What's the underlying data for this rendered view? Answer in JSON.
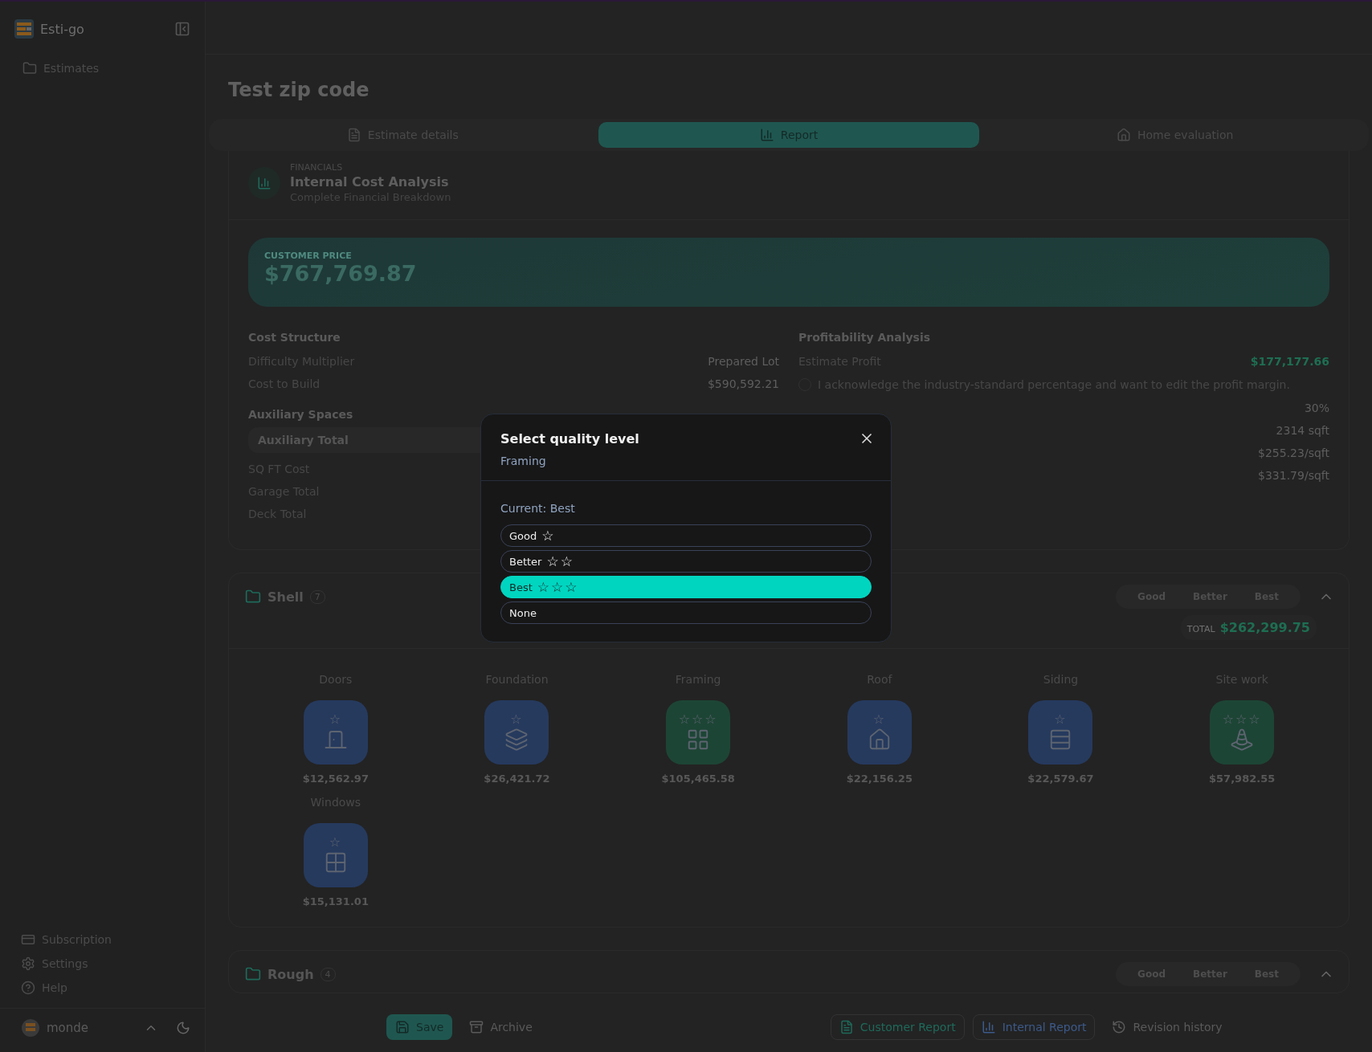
{
  "sidebar": {
    "brand": "Esti-go",
    "nav": [
      {
        "label": "Estimates",
        "kind": "folder"
      }
    ],
    "footer": [
      {
        "label": "Subscription",
        "kind": "card"
      },
      {
        "label": "Settings",
        "kind": "gear"
      },
      {
        "label": "Help",
        "kind": "help"
      }
    ],
    "user": "monde"
  },
  "page": {
    "title": "Test zip code"
  },
  "tabs": [
    {
      "label": "Estimate details",
      "kind": "doc",
      "selected": false
    },
    {
      "label": "Report",
      "kind": "chart",
      "selected": true
    },
    {
      "label": "Home evaluation",
      "kind": "house",
      "selected": false
    }
  ],
  "financials": {
    "eyebrow": "FINANCIALS",
    "title": "Internal Cost Analysis",
    "subtitle": "Complete Financial Breakdown",
    "customer_price": {
      "label": "CUSTOMER PRICE",
      "value": "$767,769.87"
    },
    "cost_structure": {
      "title": "Cost Structure",
      "rows": [
        {
          "label": "Difficulty Multiplier",
          "value": "Prepared Lot"
        },
        {
          "label": "Cost to Build",
          "value": "$590,592.21"
        }
      ]
    },
    "auxiliary": {
      "title": "Auxiliary Spaces",
      "total_label": "Auxiliary Total",
      "rows": [
        "SQ FT Cost",
        "Garage Total",
        "Deck Total"
      ]
    },
    "profitability": {
      "title": "Profitability Analysis",
      "profit_label": "Estimate Profit",
      "profit_value": "$177,177.66",
      "acknowledge": {
        "text": "I acknowledge the industry-standard percentage and want to edit the profit margin.",
        "checked": false
      },
      "values": [
        "30%",
        "2314 sqft",
        "$255.23/sqft",
        "$331.79/sqft"
      ]
    }
  },
  "sections": [
    {
      "name": "Shell",
      "count": "7",
      "expanded": true,
      "total_label": "TOTAL",
      "total": "$262,299.75",
      "quality_options": [
        {
          "label": "Good",
          "selected": false
        },
        {
          "label": "Better",
          "selected": false
        },
        {
          "label": "Best",
          "selected": false
        }
      ],
      "items": [
        {
          "name": "Doors",
          "price": "$12,562.97",
          "rating": "☆",
          "color": "#263a5e",
          "kind": "door"
        },
        {
          "name": "Foundation",
          "price": "$26,421.72",
          "rating": "☆",
          "color": "#263a5e",
          "kind": "layers"
        },
        {
          "name": "Framing",
          "price": "$105,465.58",
          "rating": "☆☆☆",
          "color": "#1d4535",
          "kind": "grid"
        },
        {
          "name": "Roof",
          "price": "$22,156.25",
          "rating": "☆",
          "color": "#263a5e",
          "kind": "house"
        },
        {
          "name": "Siding",
          "price": "$22,579.67",
          "rating": "☆",
          "color": "#263a5e",
          "kind": "rows"
        },
        {
          "name": "Site work",
          "price": "$57,982.55",
          "rating": "☆☆☆",
          "color": "#1d4535",
          "kind": "cone"
        },
        {
          "name": "Windows",
          "price": "$15,131.01",
          "rating": "☆",
          "color": "#263a5e",
          "kind": "window"
        }
      ]
    },
    {
      "name": "Rough",
      "count": "4",
      "expanded": true,
      "quality_options": [
        {
          "label": "Good",
          "selected": false
        },
        {
          "label": "Better",
          "selected": false
        },
        {
          "label": "Best",
          "selected": false
        }
      ]
    }
  ],
  "actions": [
    {
      "label": "Save",
      "kind": "save"
    },
    {
      "label": "Archive",
      "kind": "archive"
    },
    {
      "label": "Customer Report",
      "kind": "customer_report"
    },
    {
      "label": "Internal Report",
      "kind": "internal_report"
    },
    {
      "label": "Revision history",
      "kind": "history"
    }
  ],
  "modal": {
    "title": "Select quality level",
    "subtitle": "Framing",
    "current": "Current: Best",
    "options": [
      {
        "label": "Good",
        "rating": "☆",
        "selected": false
      },
      {
        "label": "Better",
        "rating": "☆☆",
        "selected": false
      },
      {
        "label": "Best",
        "rating": "☆☆☆",
        "selected": true
      },
      {
        "label": "None",
        "selected": false
      }
    ]
  }
}
